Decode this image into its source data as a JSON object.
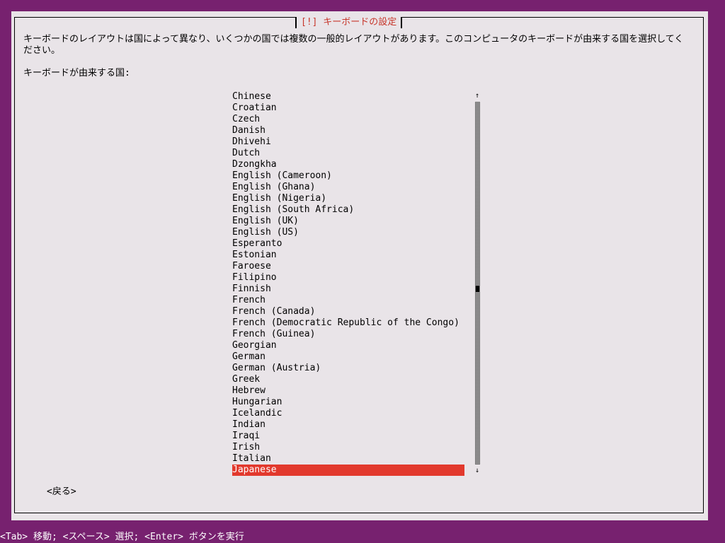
{
  "dialog": {
    "title": "[!] キーボードの設定",
    "description": "キーボードのレイアウトは国によって異なり、いくつかの国では複数の一般的レイアウトがあります。このコンピュータのキーボードが由来する国を選択してください。",
    "prompt_label": "キーボードが由来する国:",
    "back_button": "<戻る>"
  },
  "list": {
    "items": [
      "Chinese",
      "Croatian",
      "Czech",
      "Danish",
      "Dhivehi",
      "Dutch",
      "Dzongkha",
      "English (Cameroon)",
      "English (Ghana)",
      "English (Nigeria)",
      "English (South Africa)",
      "English (UK)",
      "English (US)",
      "Esperanto",
      "Estonian",
      "Faroese",
      "Filipino",
      "Finnish",
      "French",
      "French (Canada)",
      "French (Democratic Republic of the Congo)",
      "French (Guinea)",
      "Georgian",
      "German",
      "German (Austria)",
      "Greek",
      "Hebrew",
      "Hungarian",
      "Icelandic",
      "Indian",
      "Iraqi",
      "Irish",
      "Italian",
      "Japanese"
    ],
    "selected_index": 33,
    "scroll_up_icon": "↑",
    "scroll_down_icon": "↓"
  },
  "help_bar": "<Tab> 移動; <スペース> 選択; <Enter> ボタンを実行",
  "colors": {
    "background": "#77216f",
    "dialog": "#e9e4e8",
    "title": "#c7362b",
    "selection": "#e2392d"
  }
}
